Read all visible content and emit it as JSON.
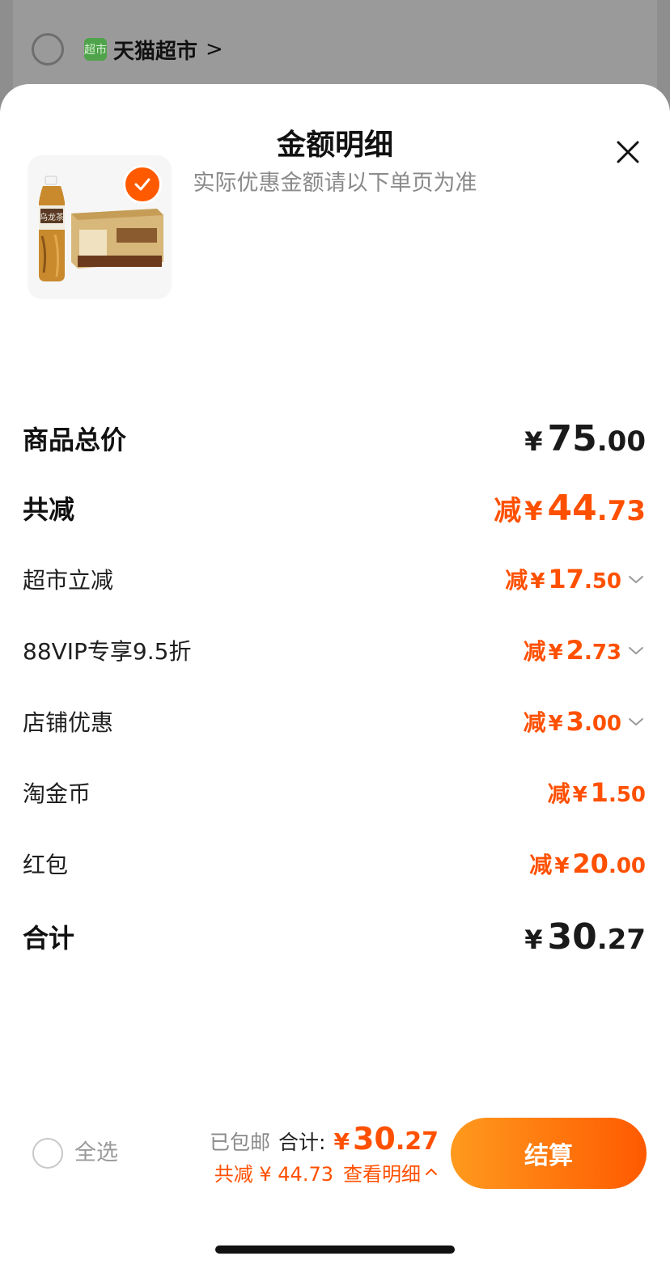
{
  "background": {
    "store_logo_text": "超市",
    "store_name": "天猫超市",
    "store_chevron": ">"
  },
  "sheet": {
    "title": "金额明细",
    "subtitle": "实际优惠金额请以下单页为准",
    "close_icon": "close-icon"
  },
  "product": {
    "thumbnail_icon": "oolong-tea-product-image",
    "selected_icon": "check-icon",
    "bottle_label": "乌龙茶"
  },
  "rows": {
    "subtotal": {
      "label": "商品总价",
      "yen": "¥",
      "int": "75",
      "dec": ".00"
    },
    "total_discount": {
      "label": "共减",
      "prefix": "减",
      "yen": "¥",
      "int": "44",
      "dec": ".73"
    },
    "supermarket_discount": {
      "label": "超市立减",
      "prefix": "减",
      "yen": "¥",
      "int": "17",
      "dec": ".50"
    },
    "vip_discount": {
      "label": "88VIP专享9.5折",
      "prefix": "减",
      "yen": "¥",
      "int": "2",
      "dec": ".73"
    },
    "shop_discount": {
      "label": "店铺优惠",
      "prefix": "减",
      "yen": "¥",
      "int": "3",
      "dec": ".00"
    },
    "taojin_coin": {
      "label": "淘金币",
      "prefix": "减",
      "yen": "¥",
      "int": "1",
      "dec": ".50"
    },
    "red_packet": {
      "label": "红包",
      "prefix": "减",
      "yen": "¥",
      "int": "20",
      "dec": ".00"
    },
    "total": {
      "label": "合计",
      "yen": "¥",
      "int": "30",
      "dec": ".27"
    }
  },
  "bottom_bar": {
    "select_all": "全选",
    "free_shipping": "已包邮",
    "total_label": "合计:",
    "total_yen": "¥",
    "total_int": "30",
    "total_dec": ".27",
    "discount_text": "共减 ¥ 44.73",
    "view_detail": "查看明细",
    "checkout": "结算"
  },
  "colors": {
    "accent": "#ff5000",
    "checkout_gradient_start": "#ff9a1e",
    "checkout_gradient_end": "#ff5a00"
  }
}
